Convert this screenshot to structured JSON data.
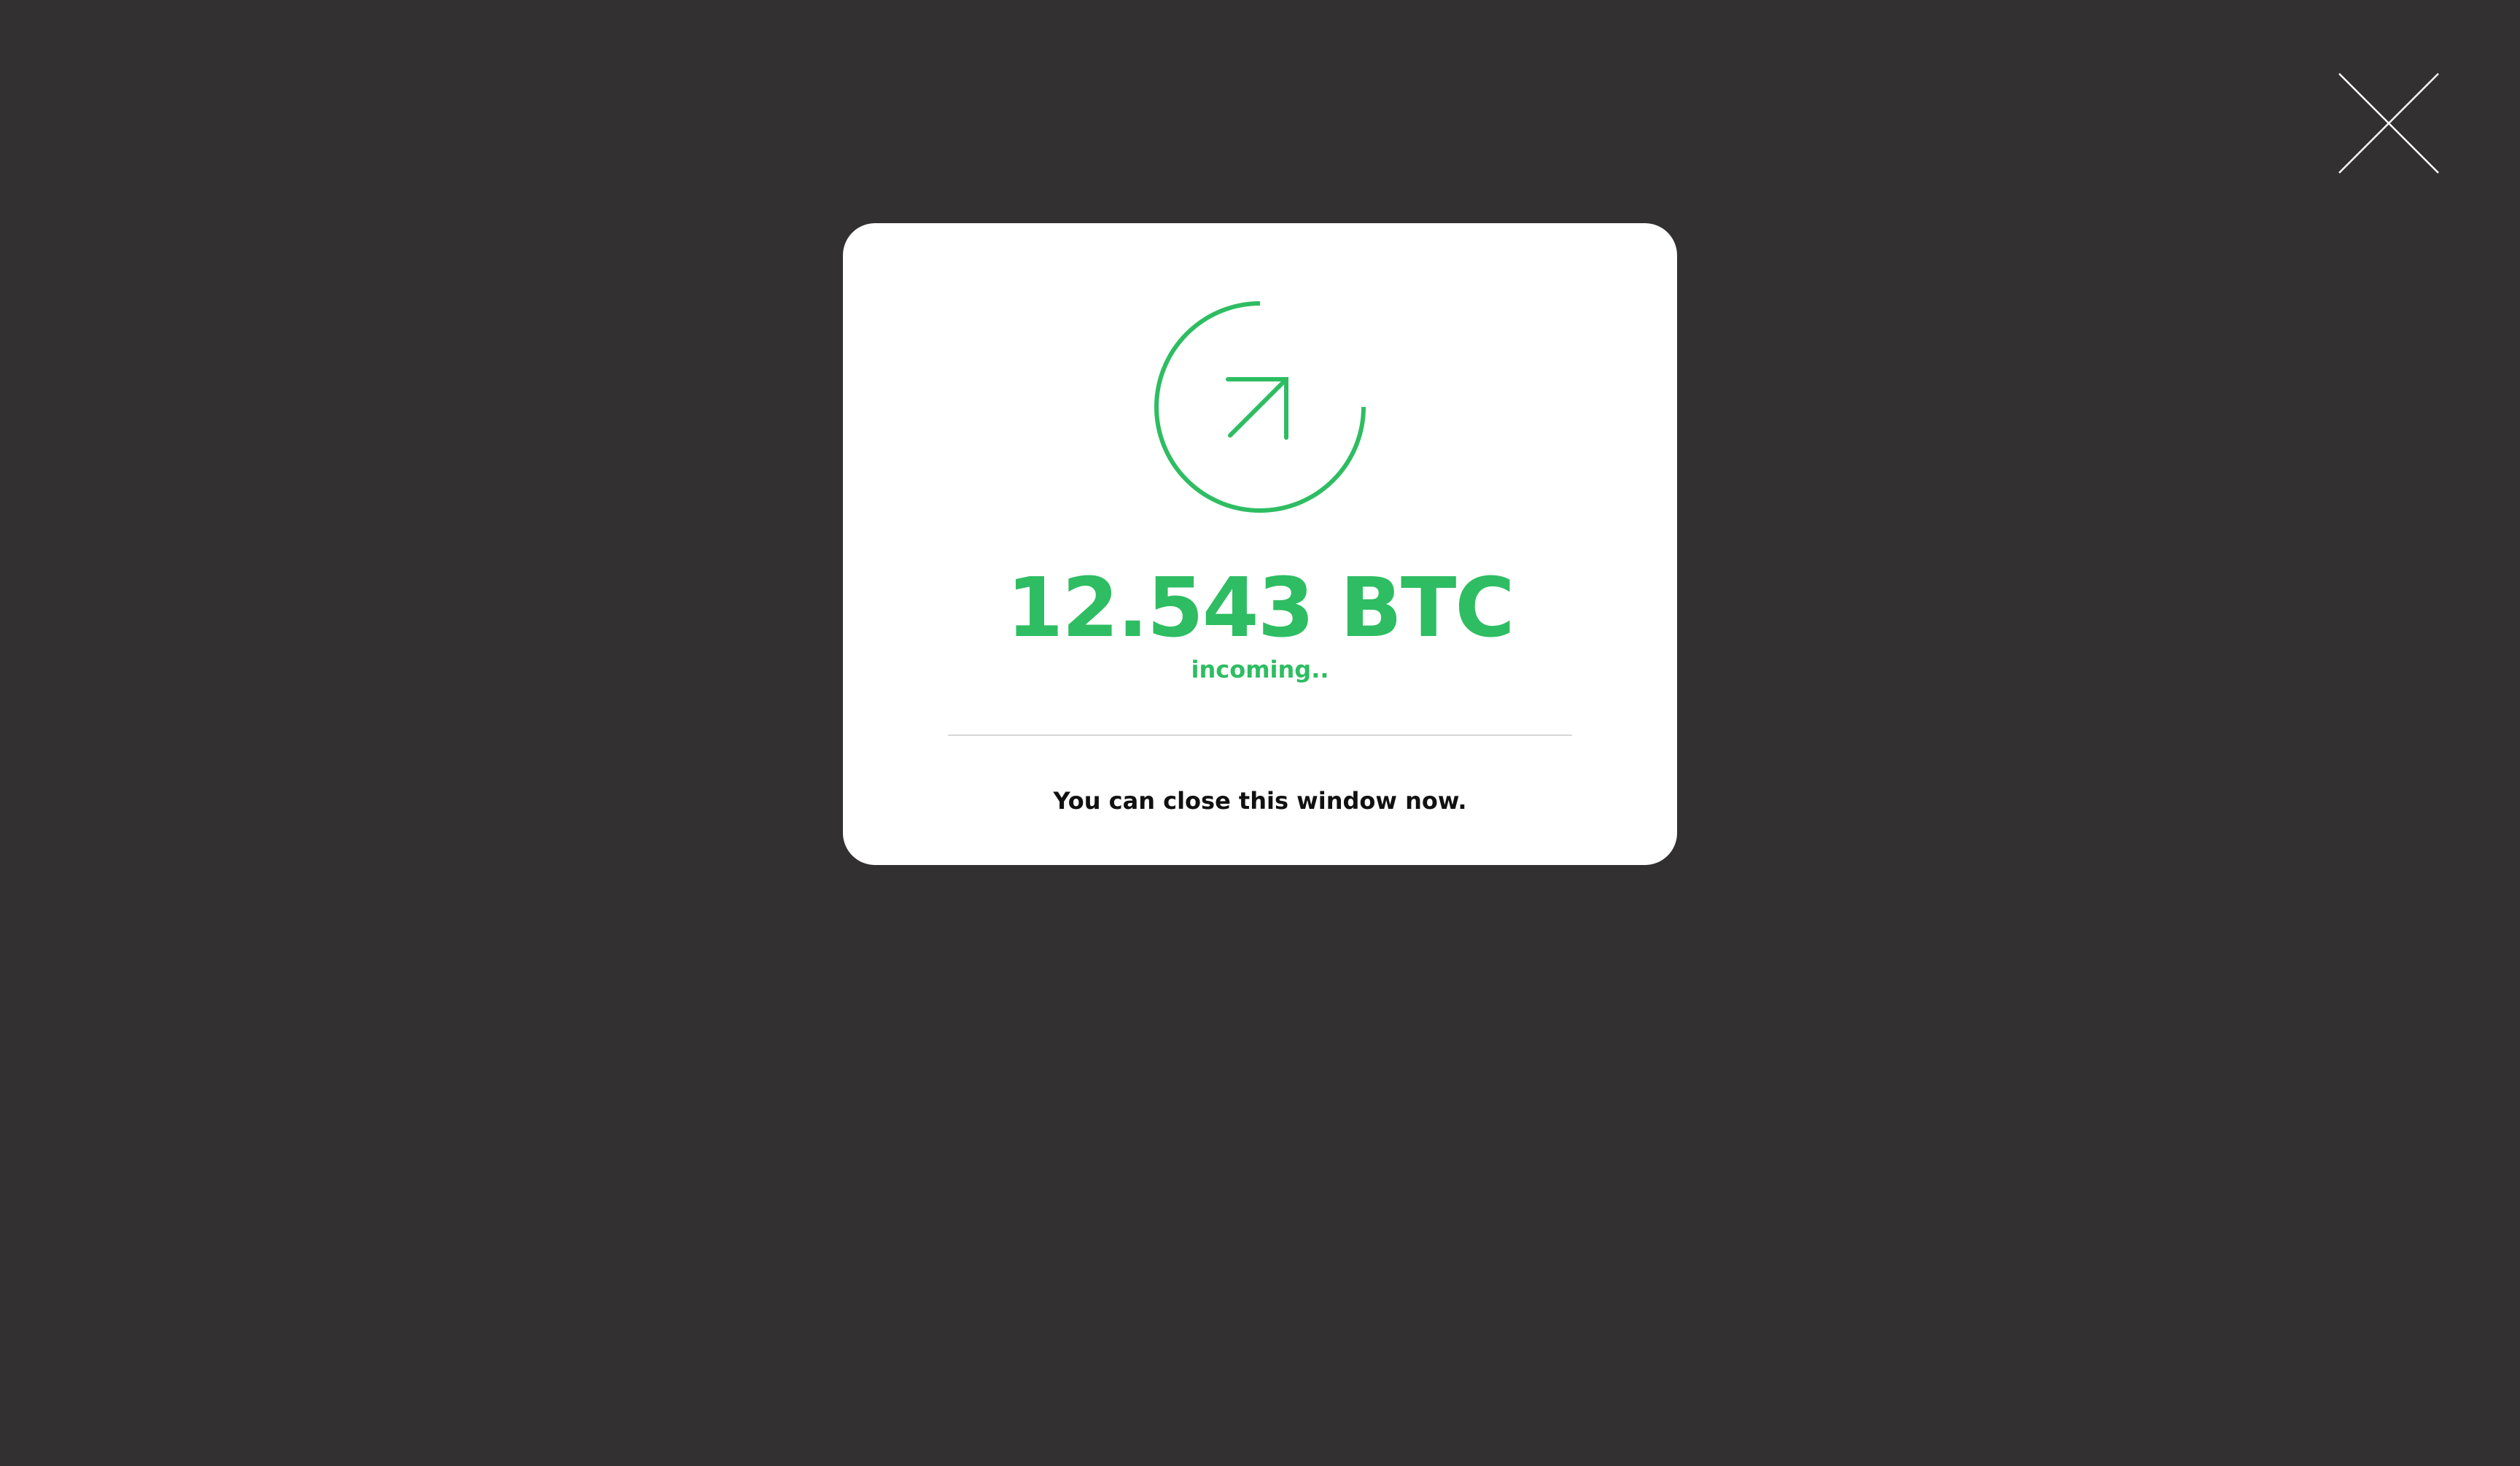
{
  "close": {
    "icon": "close-icon"
  },
  "modal": {
    "icon": "arrow-up-right-circle-icon",
    "amount": "12.543 BTC",
    "status": "incoming..",
    "instruction": "You can close this window now."
  },
  "colors": {
    "background": "#323031",
    "accent": "#2ebd62",
    "card": "#ffffff",
    "close_icon": "#ffffff"
  }
}
